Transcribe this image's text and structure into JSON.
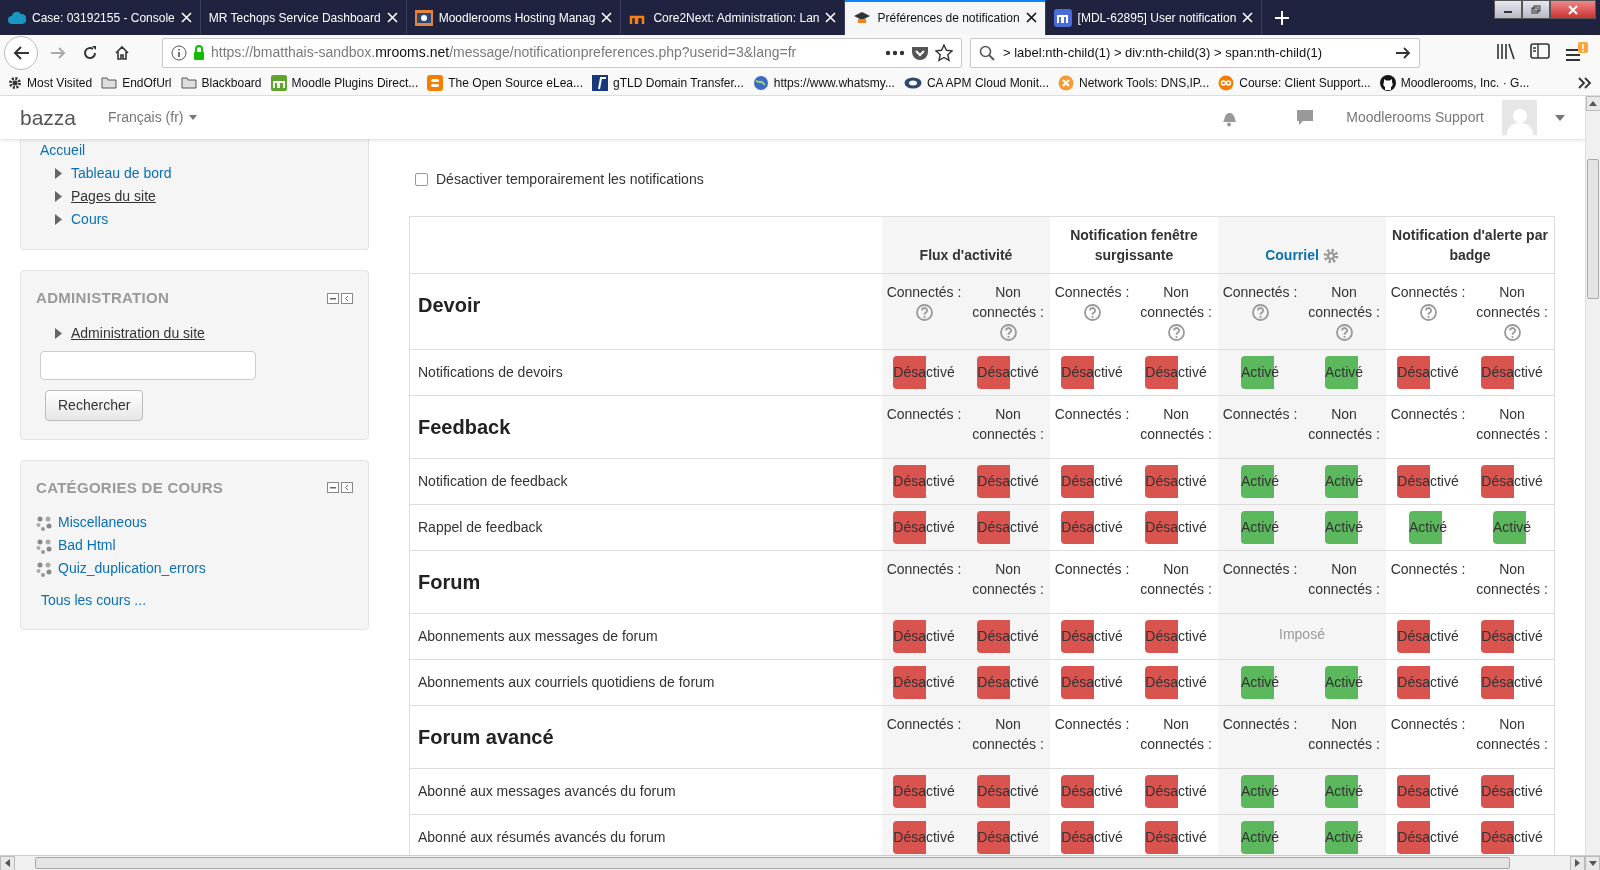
{
  "browser": {
    "tabs": [
      {
        "title": "Case: 03192155 - Console",
        "selected": false
      },
      {
        "title": "MR Techops Service Dashboard",
        "selected": false
      },
      {
        "title": "Moodlerooms Hosting Manag",
        "selected": false
      },
      {
        "title": "Core2Next: Administration: Lan",
        "selected": false
      },
      {
        "title": "Préférences de notification",
        "selected": true
      },
      {
        "title": "[MDL-62895] User notification",
        "selected": false
      }
    ],
    "url": [
      {
        "text": "https://bmatthais-sandbox.",
        "emphasis": false
      },
      {
        "text": "mrooms.net",
        "emphasis": true
      },
      {
        "text": "/message/notificationpreferences.php?userid=3&lang=fr",
        "emphasis": false
      }
    ],
    "search_value": "> label:nth-child(1) > div:nth-child(3) > span:nth-child(1)",
    "bookmarks": [
      "Most Visited",
      "EndOfUrl",
      "Blackboard",
      "Moodle Plugins Direct...",
      "The Open Source eLea...",
      "gTLD Domain Transfer...",
      "https://www.whatsmy...",
      "CA APM Cloud Monit...",
      "Network Tools: DNS,IP...",
      "Course: Client Support...",
      "Moodlerooms, Inc. · G..."
    ]
  },
  "site": {
    "brand": "bazza",
    "language": "Français (fr)",
    "user": "Moodlerooms Support"
  },
  "sidebar": {
    "navigation": [
      {
        "label": "Accueil",
        "link": true,
        "expandable": false
      },
      {
        "label": "Tableau de bord",
        "link": true,
        "expandable": true
      },
      {
        "label": "Pages du site",
        "link": false,
        "expandable": true
      },
      {
        "label": "Cours",
        "link": true,
        "expandable": true
      }
    ],
    "administration": {
      "title": "ADMINISTRATION",
      "items": [
        "Administration du site"
      ],
      "search_button": "Rechercher"
    },
    "categories": {
      "title": "CATÉGORIES DE COURS",
      "items": [
        "Miscellaneous",
        "Bad Html",
        "Quiz_duplication_errors"
      ],
      "all_link": "Tous les cours ..."
    }
  },
  "main": {
    "disable_checkbox": {
      "label": "Désactiver temporairement les notifications",
      "checked": false
    },
    "channels": [
      {
        "name": "Flux d'activité",
        "link": false,
        "settings": false
      },
      {
        "name": "Notification fenêtre surgissante",
        "link": false,
        "settings": false
      },
      {
        "name": "Courriel",
        "link": true,
        "settings": true
      },
      {
        "name": "Notification d'alerte par badge",
        "link": false,
        "settings": false
      }
    ],
    "rows": [
      {
        "kind": "section",
        "title": "Devoir",
        "help": true,
        "groups": [
          {
            "online": "Connectés :",
            "offline": "Non connectés :"
          },
          {
            "online": "Connectés :",
            "offline": "Non connectés :"
          },
          {
            "online": "Connectés :",
            "offline": "Non connectés :"
          },
          {
            "online": "Connectés :",
            "offline": "Non connectés :"
          }
        ]
      },
      {
        "kind": "item",
        "name": "Notifications de devoirs",
        "groups": [
          {
            "kind": "toggles",
            "toggles": [
              {
                "label": "Désactivé",
                "on": false
              },
              {
                "label": "Désactivé",
                "on": false
              }
            ]
          },
          {
            "kind": "toggles",
            "toggles": [
              {
                "label": "Désactivé",
                "on": false
              },
              {
                "label": "Désactivé",
                "on": false
              }
            ]
          },
          {
            "kind": "toggles",
            "toggles": [
              {
                "label": "Activé",
                "on": true
              },
              {
                "label": "Activé",
                "on": true
              }
            ]
          },
          {
            "kind": "toggles",
            "toggles": [
              {
                "label": "Désactivé",
                "on": false
              },
              {
                "label": "Désactivé",
                "on": false
              }
            ]
          }
        ]
      },
      {
        "kind": "section",
        "title": "Feedback",
        "help": false,
        "groups": [
          {
            "online": "Connectés :",
            "offline": "Non connectés :"
          },
          {
            "online": "Connectés :",
            "offline": "Non connectés :"
          },
          {
            "online": "Connectés :",
            "offline": "Non connectés :"
          },
          {
            "online": "Connectés :",
            "offline": "Non connectés :"
          }
        ]
      },
      {
        "kind": "item",
        "name": "Notification de feedback",
        "groups": [
          {
            "kind": "toggles",
            "toggles": [
              {
                "label": "Désactivé",
                "on": false
              },
              {
                "label": "Désactivé",
                "on": false
              }
            ]
          },
          {
            "kind": "toggles",
            "toggles": [
              {
                "label": "Désactivé",
                "on": false
              },
              {
                "label": "Désactivé",
                "on": false
              }
            ]
          },
          {
            "kind": "toggles",
            "toggles": [
              {
                "label": "Activé",
                "on": true
              },
              {
                "label": "Activé",
                "on": true
              }
            ]
          },
          {
            "kind": "toggles",
            "toggles": [
              {
                "label": "Désactivé",
                "on": false
              },
              {
                "label": "Désactivé",
                "on": false
              }
            ]
          }
        ]
      },
      {
        "kind": "item",
        "name": "Rappel de feedback",
        "groups": [
          {
            "kind": "toggles",
            "toggles": [
              {
                "label": "Désactivé",
                "on": false
              },
              {
                "label": "Désactivé",
                "on": false
              }
            ]
          },
          {
            "kind": "toggles",
            "toggles": [
              {
                "label": "Désactivé",
                "on": false
              },
              {
                "label": "Désactivé",
                "on": false
              }
            ]
          },
          {
            "kind": "toggles",
            "toggles": [
              {
                "label": "Activé",
                "on": true
              },
              {
                "label": "Activé",
                "on": true
              }
            ]
          },
          {
            "kind": "toggles",
            "toggles": [
              {
                "label": "Activé",
                "on": true
              },
              {
                "label": "Activé",
                "on": true
              }
            ]
          }
        ]
      },
      {
        "kind": "section",
        "title": "Forum",
        "help": false,
        "groups": [
          {
            "online": "Connectés :",
            "offline": "Non connectés :"
          },
          {
            "online": "Connectés :",
            "offline": "Non connectés :"
          },
          {
            "online": "Connectés :",
            "offline": "Non connectés :"
          },
          {
            "online": "Connectés :",
            "offline": "Non connectés :"
          }
        ]
      },
      {
        "kind": "item",
        "name": "Abonnements aux messages de forum",
        "groups": [
          {
            "kind": "toggles",
            "toggles": [
              {
                "label": "Désactivé",
                "on": false
              },
              {
                "label": "Désactivé",
                "on": false
              }
            ]
          },
          {
            "kind": "toggles",
            "toggles": [
              {
                "label": "Désactivé",
                "on": false
              },
              {
                "label": "Désactivé",
                "on": false
              }
            ]
          },
          {
            "kind": "locked",
            "text": "Imposé"
          },
          {
            "kind": "toggles",
            "toggles": [
              {
                "label": "Désactivé",
                "on": false
              },
              {
                "label": "Désactivé",
                "on": false
              }
            ]
          }
        ]
      },
      {
        "kind": "item",
        "name": "Abonnements aux courriels quotidiens de forum",
        "groups": [
          {
            "kind": "toggles",
            "toggles": [
              {
                "label": "Désactivé",
                "on": false
              },
              {
                "label": "Désactivé",
                "on": false
              }
            ]
          },
          {
            "kind": "toggles",
            "toggles": [
              {
                "label": "Désactivé",
                "on": false
              },
              {
                "label": "Désactivé",
                "on": false
              }
            ]
          },
          {
            "kind": "toggles",
            "toggles": [
              {
                "label": "Activé",
                "on": true
              },
              {
                "label": "Activé",
                "on": true
              }
            ]
          },
          {
            "kind": "toggles",
            "toggles": [
              {
                "label": "Désactivé",
                "on": false
              },
              {
                "label": "Désactivé",
                "on": false
              }
            ]
          }
        ]
      },
      {
        "kind": "section",
        "title": "Forum avancé",
        "help": false,
        "groups": [
          {
            "online": "Connectés :",
            "offline": "Non connectés :"
          },
          {
            "online": "Connectés :",
            "offline": "Non connectés :"
          },
          {
            "online": "Connectés :",
            "offline": "Non connectés :"
          },
          {
            "online": "Connectés :",
            "offline": "Non connectés :"
          }
        ]
      },
      {
        "kind": "item",
        "name": "Abonné aux messages avancés du forum",
        "groups": [
          {
            "kind": "toggles",
            "toggles": [
              {
                "label": "Désactivé",
                "on": false
              },
              {
                "label": "Désactivé",
                "on": false
              }
            ]
          },
          {
            "kind": "toggles",
            "toggles": [
              {
                "label": "Désactivé",
                "on": false
              },
              {
                "label": "Désactivé",
                "on": false
              }
            ]
          },
          {
            "kind": "toggles",
            "toggles": [
              {
                "label": "Activé",
                "on": true
              },
              {
                "label": "Activé",
                "on": true
              }
            ]
          },
          {
            "kind": "toggles",
            "toggles": [
              {
                "label": "Désactivé",
                "on": false
              },
              {
                "label": "Désactivé",
                "on": false
              }
            ]
          }
        ]
      },
      {
        "kind": "item",
        "name": "Abonné aux résumés avancés du forum",
        "groups": [
          {
            "kind": "toggles",
            "toggles": [
              {
                "label": "Désactivé",
                "on": false
              },
              {
                "label": "Désactivé",
                "on": false
              }
            ]
          },
          {
            "kind": "toggles",
            "toggles": [
              {
                "label": "Désactivé",
                "on": false
              },
              {
                "label": "Désactivé",
                "on": false
              }
            ]
          },
          {
            "kind": "toggles",
            "toggles": [
              {
                "label": "Activé",
                "on": true
              },
              {
                "label": "Activé",
                "on": true
              }
            ]
          },
          {
            "kind": "toggles",
            "toggles": [
              {
                "label": "Désactivé",
                "on": false
              },
              {
                "label": "Désactivé",
                "on": false
              }
            ]
          }
        ]
      }
    ]
  }
}
